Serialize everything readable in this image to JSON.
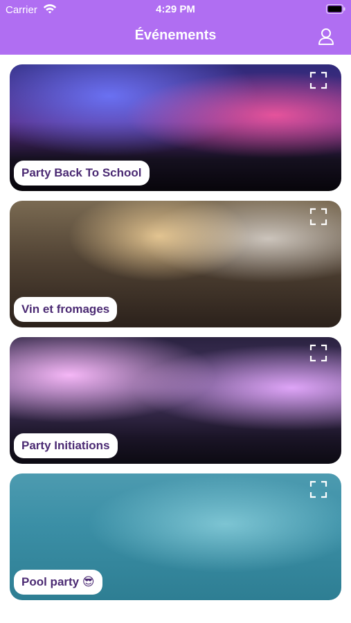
{
  "status_bar": {
    "carrier": "Carrier",
    "time": "4:29 PM"
  },
  "header": {
    "title": "Événements"
  },
  "events": [
    {
      "label": "Party Back To School"
    },
    {
      "label": "Vin et fromages"
    },
    {
      "label": "Party Initiations"
    },
    {
      "label": "Pool party 😎"
    }
  ],
  "colors": {
    "header_bg": "#b06ef2",
    "label_text": "#4b2a73"
  },
  "icons": {
    "profile": "person-icon",
    "expand": "fullscreen-icon",
    "wifi": "wifi-icon",
    "battery": "battery-icon"
  }
}
